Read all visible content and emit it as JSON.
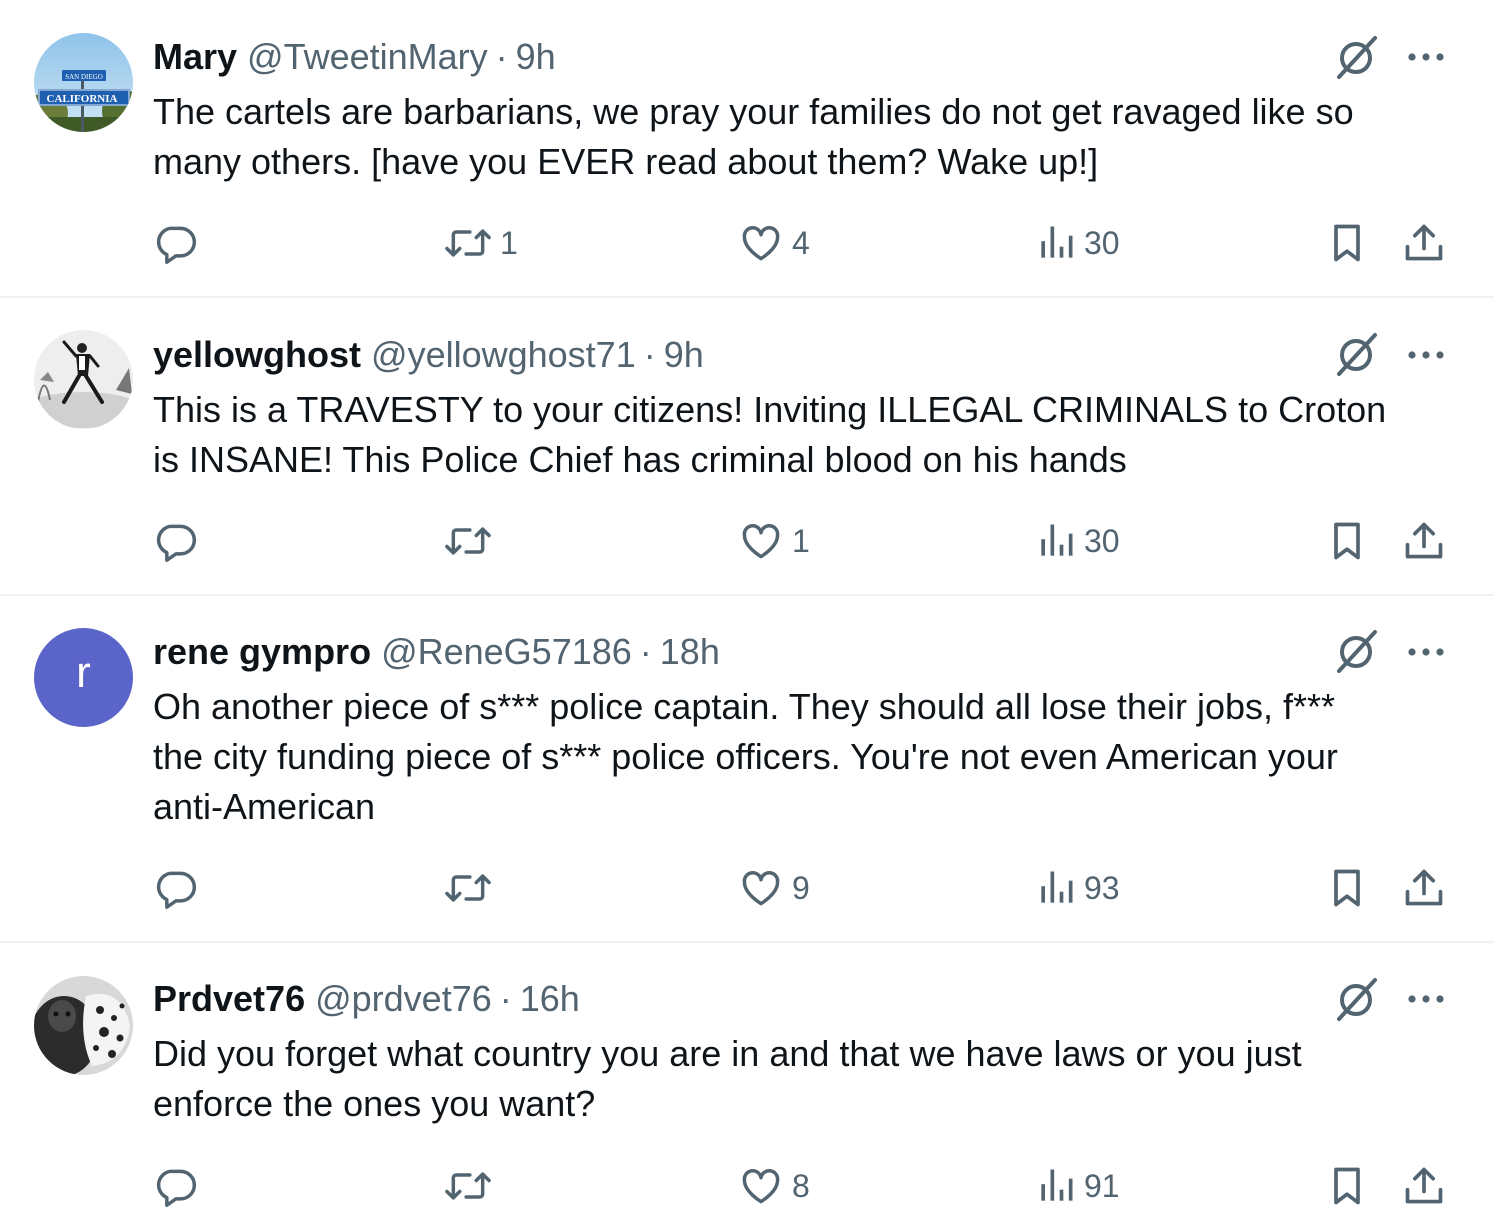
{
  "colors": {
    "text_primary": "#0f1419",
    "text_secondary": "#536471",
    "divider": "#eff3f4",
    "default_avatar": "#5b64c8"
  },
  "icons": {
    "reply": "reply-icon",
    "repost": "repost-icon",
    "like": "heart-icon",
    "views": "views-icon",
    "bookmark": "bookmark-icon",
    "share": "share-icon",
    "grok": "grok-icon",
    "more": "more-icon"
  },
  "tweets": [
    {
      "name": "Mary",
      "handle": "@TweetinMary",
      "separator": "·",
      "time": "9h",
      "text_lines": [
        "The cartels are barbarians, we pray your families do not get ravaged like so",
        "many others.  [have you EVER read about them?  Wake up!]"
      ],
      "replies": "",
      "reposts": "1",
      "likes": "4",
      "views": "30",
      "avatar_sign_lines": [
        "SAN DIEGO",
        "CALIFORNIA"
      ]
    },
    {
      "name": "yellowghost",
      "handle": "@yellowghost71",
      "separator": "·",
      "time": "9h",
      "text_lines": [
        "This is a TRAVESTY to your citizens! Inviting ILLEGAL CRIMINALS to Croton",
        "is INSANE!  This Police Chief has criminal blood on his hands"
      ],
      "replies": "",
      "reposts": "",
      "likes": "1",
      "views": "30"
    },
    {
      "name": "rene gympro",
      "handle": "@ReneG57186",
      "separator": "·",
      "time": "18h",
      "avatar_letter": "r",
      "text_lines": [
        "Oh another piece of s*** police captain. They should all lose their jobs, f***",
        "the city funding piece of s*** police officers. You're not even American your",
        "anti-American"
      ],
      "replies": "",
      "reposts": "",
      "likes": "9",
      "views": "93"
    },
    {
      "name": "Prdvet76",
      "handle": "@prdvet76",
      "separator": "·",
      "time": "16h",
      "text_lines": [
        "Did you forget what country you are in and that we have laws or you just",
        "enforce the ones you want?"
      ],
      "replies": "",
      "reposts": "",
      "likes": "8",
      "views": "91"
    }
  ]
}
